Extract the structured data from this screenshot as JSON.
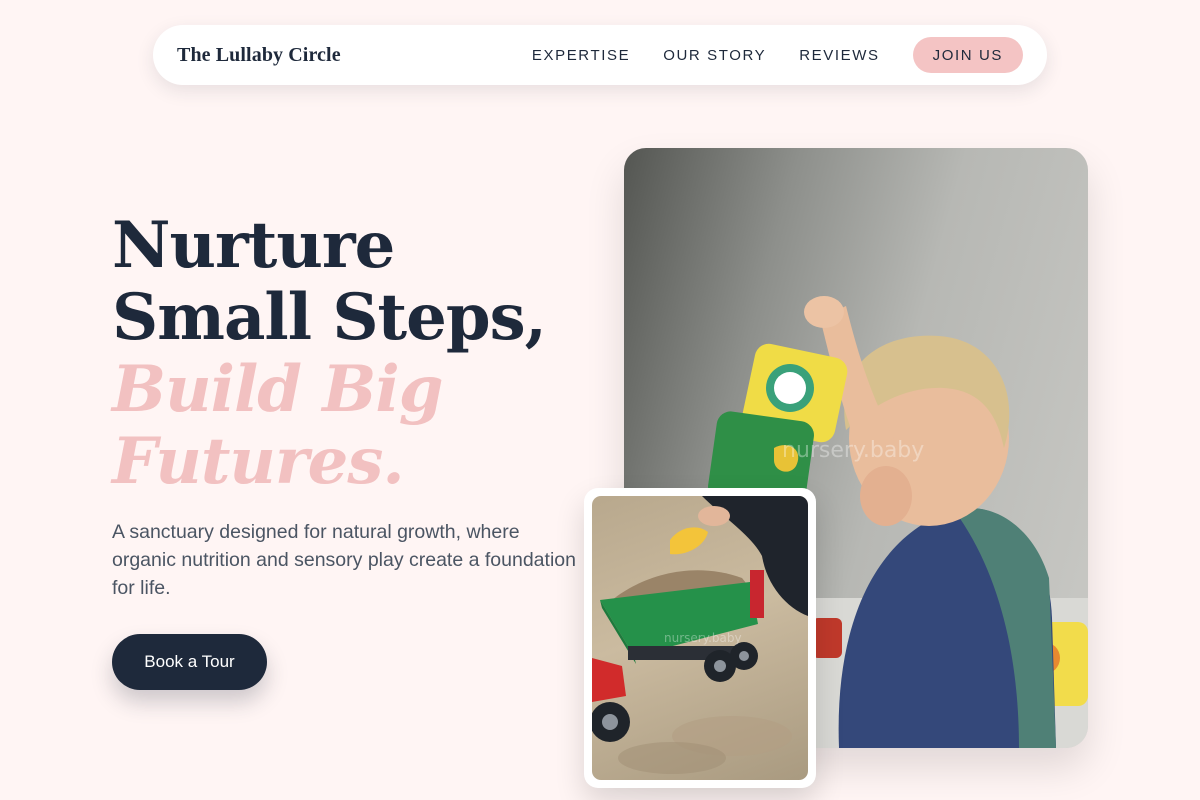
{
  "nav": {
    "brand": "The Lullaby Circle",
    "links": [
      "EXPERTISE",
      "OUR STORY",
      "REVIEWS"
    ],
    "cta": "JOIN US"
  },
  "hero": {
    "title_line1": "Nurture",
    "title_line2": "Small Steps,",
    "accent_line1": "Build Big",
    "accent_line2": "Futures.",
    "description": "A sanctuary designed for natural growth, where organic nutrition and sensory play create a foundation for life.",
    "button": "Book a Tour"
  },
  "images": {
    "main_watermark": "nursery.baby",
    "sub_watermark": "nursery.baby"
  },
  "colors": {
    "background": "#fff5f4",
    "navy": "#1e293b",
    "accent_pink": "#f2c1c1"
  }
}
